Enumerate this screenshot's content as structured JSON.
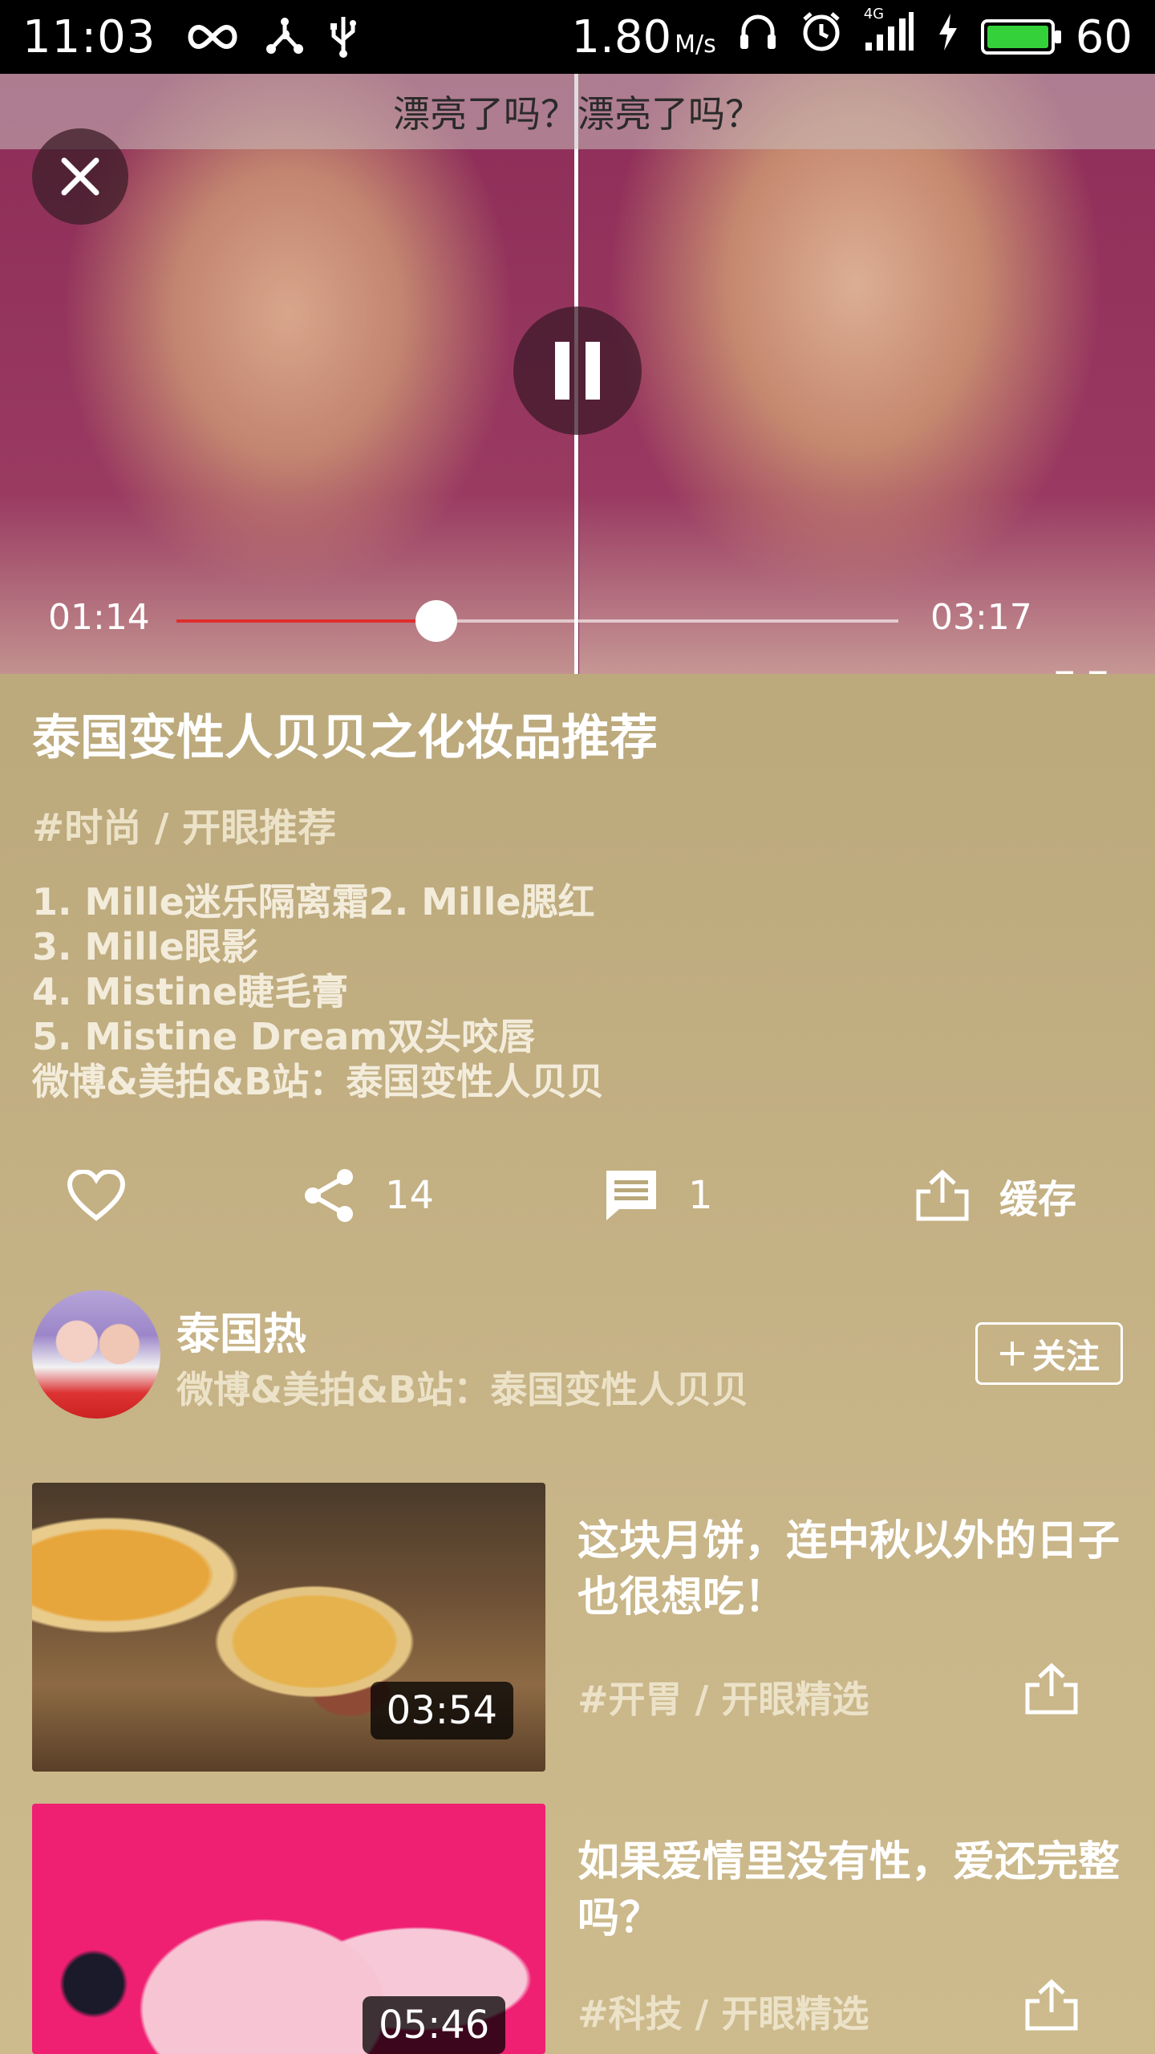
{
  "status_bar": {
    "time": "11:03",
    "speed_value": "1.80",
    "speed_unit": "M/s",
    "network": "4G",
    "battery_level": "60"
  },
  "player": {
    "subtitle": "漂亮了吗？漂亮了吗？",
    "current_time": "01:14",
    "total_time": "03:17",
    "progress": 0.36
  },
  "video": {
    "title": "泰国变性人贝贝之化妆品推荐",
    "tags": "#时尚 / 开眼推荐",
    "description_lines": [
      "1. Mille迷乐隔离霜2. Mille腮红",
      "3. Mille眼影",
      "4. Mistine睫毛膏",
      "5. Mistine Dream双头咬唇",
      "微博&美拍&B站：泰国变性人贝贝"
    ]
  },
  "actions": {
    "share_count": "14",
    "comment_count": "1",
    "cache_label": "缓存"
  },
  "author": {
    "name": "泰国热",
    "description": "微博&美拍&B站：泰国变性人贝贝",
    "follow_label": "关注"
  },
  "related": [
    {
      "title": "这块月饼，连中秋以外的日子也很想吃！",
      "tags": "#开胃 / 开眼精选",
      "duration": "03:54"
    },
    {
      "title": "如果爱情里没有性，爱还完整吗？",
      "tags": "#科技 / 开眼精选",
      "duration": "05:46"
    }
  ],
  "colors": {
    "background": "#bdaa7d",
    "progress_played": "#e02d2d",
    "battery_fill": "#35d13a"
  },
  "icons": [
    "infinity-icon",
    "share-node-icon",
    "usb-icon",
    "headphones-icon",
    "alarm-icon",
    "signal-icon",
    "charging-icon",
    "battery-icon",
    "close-icon",
    "pause-icon",
    "fullscreen-icon",
    "heart-icon",
    "share-icon",
    "comment-icon",
    "upload-icon",
    "plus-icon"
  ]
}
